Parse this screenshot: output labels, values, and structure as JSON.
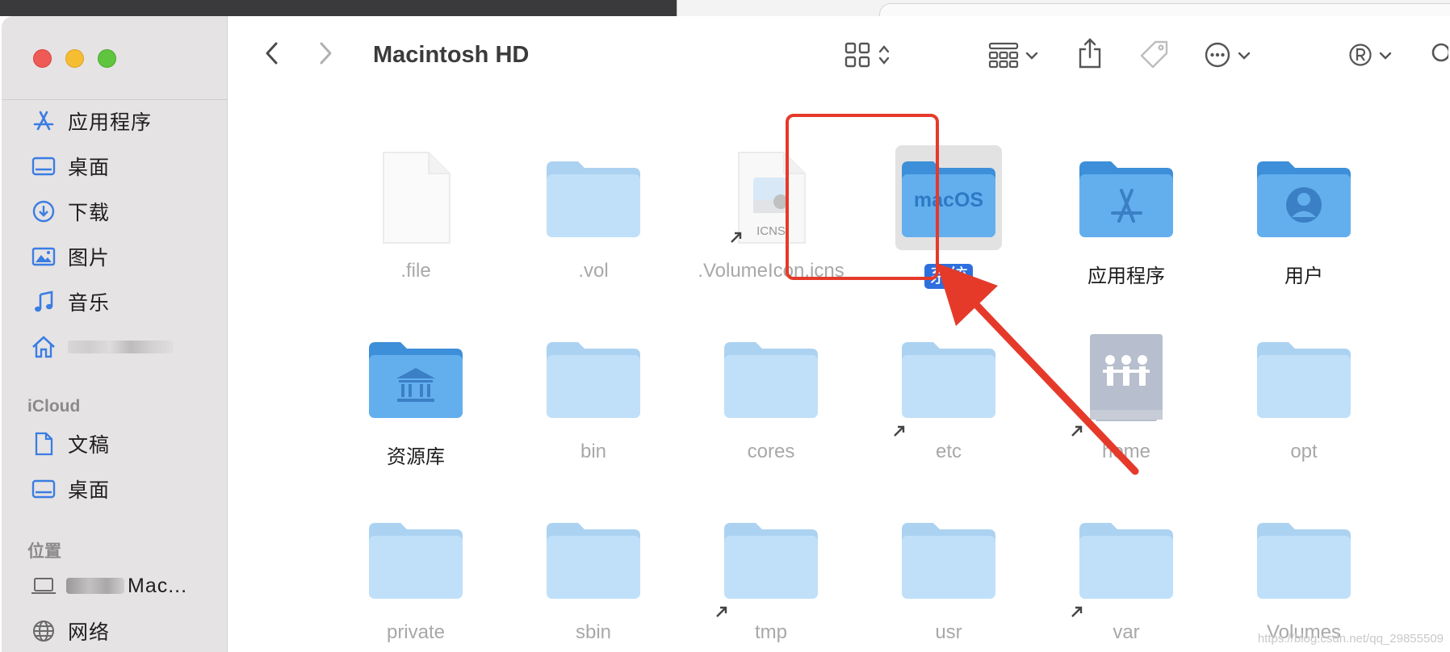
{
  "window": {
    "title": "Macintosh HD"
  },
  "sidebar": {
    "favorites": [
      {
        "label": "应用程序",
        "icon": "app-store-icon"
      },
      {
        "label": "桌面",
        "icon": "desktop-icon"
      },
      {
        "label": "下载",
        "icon": "download-icon"
      },
      {
        "label": "图片",
        "icon": "photos-icon"
      },
      {
        "label": "音乐",
        "icon": "music-icon"
      },
      {
        "label": "",
        "icon": "home-icon"
      }
    ],
    "icloud_header": "iCloud",
    "icloud": [
      {
        "label": "文稿",
        "icon": "document-icon"
      },
      {
        "label": "桌面",
        "icon": "desktop-icon"
      }
    ],
    "locations_header": "位置",
    "locations": [
      {
        "label": "Mac...",
        "icon": "laptop-icon"
      },
      {
        "label": "网络",
        "icon": "network-icon"
      }
    ]
  },
  "toolbar": {
    "back_icon": "chevron-left-icon",
    "forward_icon": "chevron-right-icon",
    "view_icon": "grid-view-icon",
    "group_icon": "group-icon",
    "share_icon": "share-icon",
    "tag_icon": "tag-icon",
    "more_icon": "ellipsis-circle-icon",
    "user_icon": "registered-icon",
    "search_icon": "search-icon"
  },
  "files": [
    {
      "name": ".file",
      "kind": "document",
      "dim": true
    },
    {
      "name": ".vol",
      "kind": "folder",
      "dim": true
    },
    {
      "name": ".VolumeIcon.icns",
      "kind": "icns",
      "dim": true,
      "icon_text": "ICNS"
    },
    {
      "name": "系统",
      "kind": "macos-folder",
      "selected": true,
      "icon_text": "macOS"
    },
    {
      "name": "应用程序",
      "kind": "apps-folder"
    },
    {
      "name": "用户",
      "kind": "users-folder"
    },
    {
      "name": "资源库",
      "kind": "library-folder"
    },
    {
      "name": "bin",
      "kind": "folder",
      "dim": true
    },
    {
      "name": "cores",
      "kind": "folder",
      "dim": true
    },
    {
      "name": "etc",
      "kind": "folder",
      "dim": true
    },
    {
      "name": "home",
      "kind": "server",
      "dim": true
    },
    {
      "name": "opt",
      "kind": "folder",
      "dim": true
    },
    {
      "name": "private",
      "kind": "folder",
      "dim": true
    },
    {
      "name": "sbin",
      "kind": "folder",
      "dim": true
    },
    {
      "name": "tmp",
      "kind": "folder",
      "dim": true
    },
    {
      "name": "usr",
      "kind": "folder",
      "dim": true
    },
    {
      "name": "var",
      "kind": "folder",
      "dim": true
    },
    {
      "name": "Volumes",
      "kind": "folder",
      "dim": true
    }
  ],
  "colors": {
    "highlight": "#e53a2a",
    "selection": "#2e6fde",
    "folder": "#6cb4ec"
  },
  "watermark": "https://blog.csdn.net/qq_29855509"
}
